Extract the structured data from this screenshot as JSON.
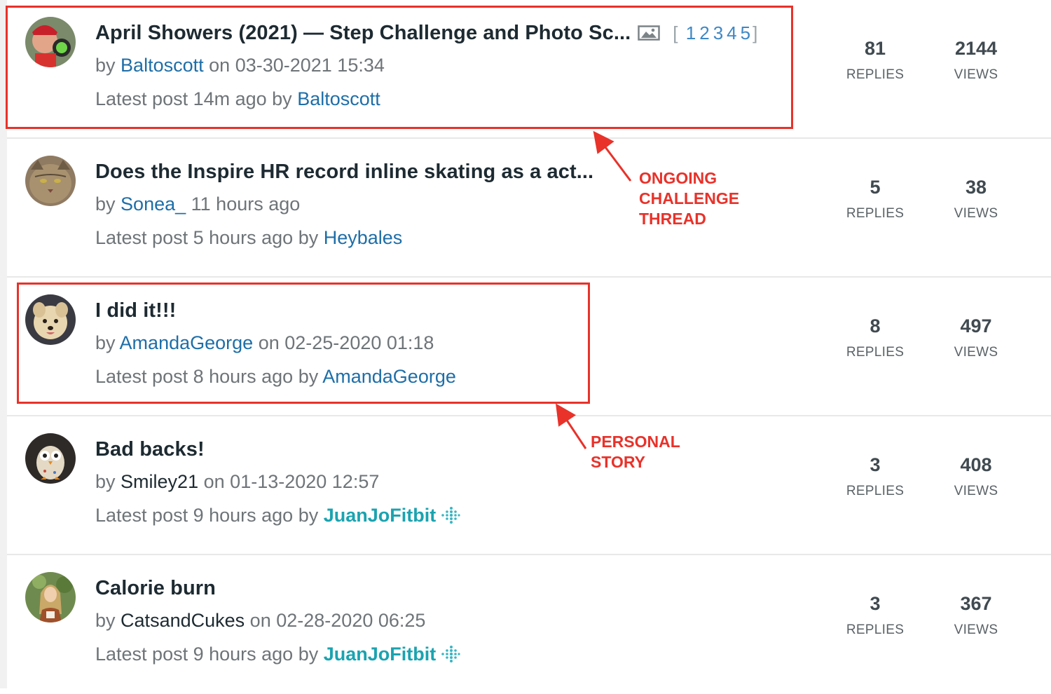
{
  "threads": [
    {
      "title": "April Showers (2021) — Step Challenge and Photo Sc...",
      "pages": [
        "1",
        "2",
        "3",
        "4",
        "5"
      ],
      "by": "by",
      "author": "Baltoscott",
      "date_prefix": "on",
      "date": "03-30-2021 15:34",
      "latest_prefix": "Latest post 14m ago by",
      "latest_user": "Baltoscott",
      "replies": "81",
      "views": "2144"
    },
    {
      "title": "Does the Inspire HR record inline skating as a act...",
      "by": "by",
      "author": "Sonea_",
      "time": "11 hours ago",
      "latest_prefix": "Latest post 5 hours ago by",
      "latest_user": "Heybales",
      "replies": "5",
      "views": "38"
    },
    {
      "title": "I did it!!!",
      "by": "by",
      "author": "AmandaGeorge",
      "date_prefix": "on",
      "date": "02-25-2020 01:18",
      "latest_prefix": "Latest post 8 hours ago by",
      "latest_user": "AmandaGeorge",
      "replies": "8",
      "views": "497"
    },
    {
      "title": "Bad backs!",
      "by": "by",
      "author": "Smiley21",
      "date_prefix": "on",
      "date": "01-13-2020 12:57",
      "latest_prefix": "Latest post 9 hours ago by",
      "latest_user": "JuanJoFitbit",
      "replies": "3",
      "views": "408"
    },
    {
      "title": "Calorie burn",
      "by": "by",
      "author": "CatsandCukes",
      "date_prefix": "on",
      "date": "02-28-2020 06:25",
      "latest_prefix": "Latest post 9 hours ago by",
      "latest_user": "JuanJoFitbit",
      "replies": "3",
      "views": "367"
    }
  ],
  "labels": {
    "replies": "REPLIES",
    "views": "VIEWS"
  },
  "annotations": {
    "ongoing": [
      "ONGOING",
      "CHALLENGE",
      "THREAD"
    ],
    "personal": [
      "PERSONAL",
      "STORY"
    ]
  },
  "icons": {
    "image": "image-icon",
    "staff": "fitbit-logo-icon"
  },
  "colors": {
    "annotation": "#e8322a",
    "user_link": "#1e6ea8",
    "staff_link": "#1aa3b0",
    "title": "#1d2a31"
  }
}
